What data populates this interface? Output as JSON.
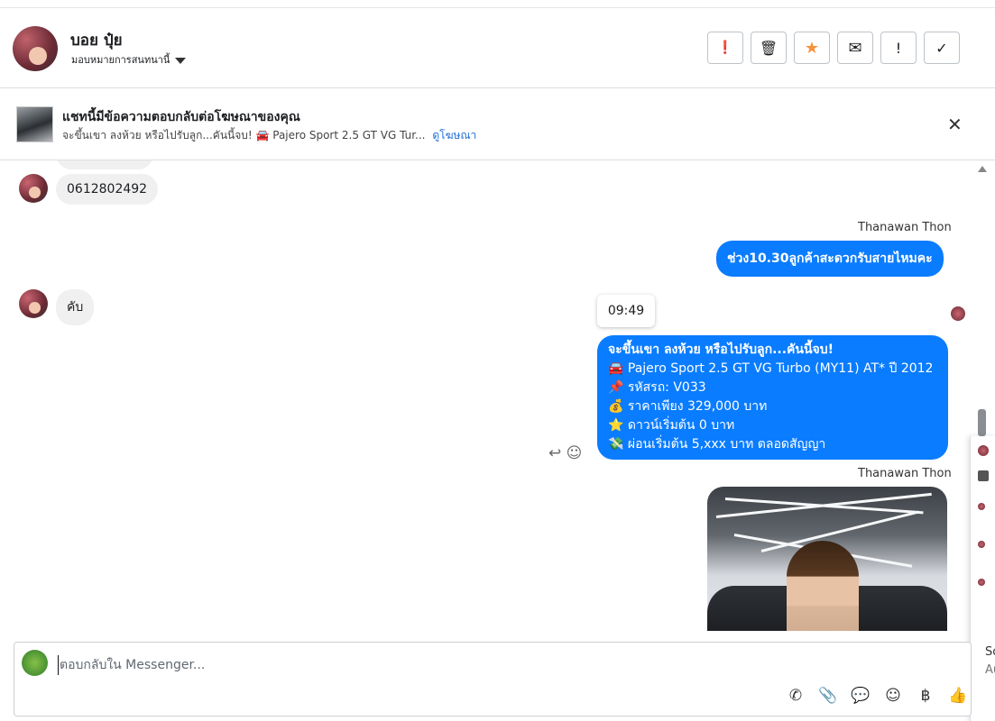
{
  "header": {
    "name": "บอย ปุ๋ย",
    "assign_label": "มอบหมายการสนทนานี้",
    "buttons": [
      {
        "icon": "exclamation-circle-icon",
        "glyph": "❗"
      },
      {
        "icon": "trash-icon",
        "glyph": "🗑"
      },
      {
        "icon": "star-icon",
        "glyph": "★",
        "color": "#f7923b"
      },
      {
        "icon": "envelope-icon",
        "glyph": "✉"
      },
      {
        "icon": "exclamation-icon",
        "glyph": "!"
      },
      {
        "icon": "check-icon",
        "glyph": "✓"
      }
    ]
  },
  "ad_bar": {
    "title": "แชทนี้มีข้อความตอบกลับต่อโฆษณาของคุณ",
    "subtitle": "จะขึ้นเขา ลงห้วย หรือไปรับลูก...คันนี้จบ! 🚘 Pajero Sport 2.5 GT VG Tur...",
    "link": "ดูโฆษณา",
    "close_glyph": "✕"
  },
  "messages": {
    "phone": "0612802492",
    "agent_name_1": "Thanawan Thon",
    "agent_msg_1": "ช่วง10.30ลูกค้าสะดวกรับสายไหมคะ",
    "customer_reply": "คับ",
    "timestamp": "09:49",
    "ad_lines": [
      "จะขึ้นเขา ลงห้วย หรือไปรับลูก...คันนี้จบ!",
      "🚘 Pajero Sport 2.5 GT VG Turbo (MY11) AT* ปี 2012",
      "📌 รหัสรถ: V033",
      "💰 ราคาเพียง 329,000 บาท",
      "⭐ ดาวน์เริ่มต้น 0 บาท",
      "💸 ผ่อนเริ่มต้น 5,xxx บาท ตลอดสัญญา"
    ],
    "agent_name_2": "Thanawan Thon",
    "reply_glyph": "↩",
    "emoji_glyph": "☺"
  },
  "side_panel": {
    "fragment_1": "So",
    "fragment_2": "Au"
  },
  "composer": {
    "placeholder": "ตอบกลับใน Messenger...",
    "tools": [
      {
        "icon": "phone-icon",
        "glyph": "✆"
      },
      {
        "icon": "attachment-icon",
        "glyph": "📎"
      },
      {
        "icon": "saved-reply-icon",
        "glyph": "💬"
      },
      {
        "icon": "emoji-icon",
        "glyph": "☺"
      },
      {
        "icon": "baht-icon",
        "glyph": "฿"
      },
      {
        "icon": "like-icon",
        "glyph": "👍"
      }
    ]
  },
  "colors": {
    "accent_blue": "#0a7cff",
    "link_blue": "#216fdb",
    "star_orange": "#f7923b"
  }
}
